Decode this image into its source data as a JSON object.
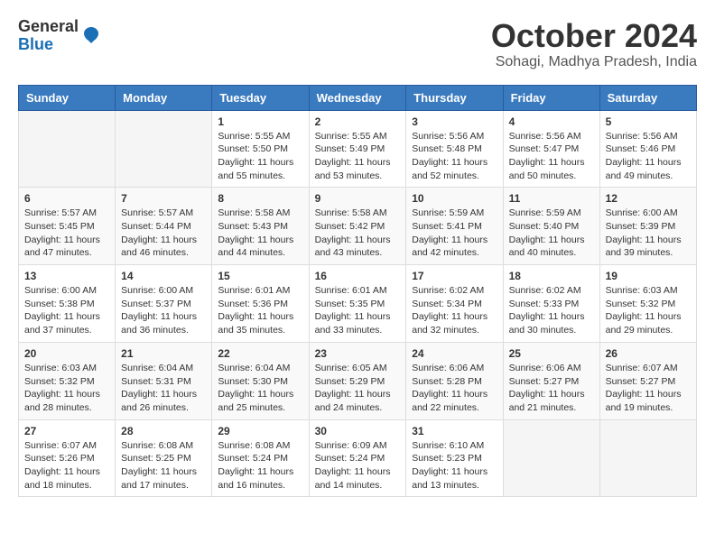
{
  "logo": {
    "general": "General",
    "blue": "Blue"
  },
  "title": "October 2024",
  "subtitle": "Sohagi, Madhya Pradesh, India",
  "headers": [
    "Sunday",
    "Monday",
    "Tuesday",
    "Wednesday",
    "Thursday",
    "Friday",
    "Saturday"
  ],
  "weeks": [
    [
      {
        "day": "",
        "info": ""
      },
      {
        "day": "",
        "info": ""
      },
      {
        "day": "1",
        "info": "Sunrise: 5:55 AM\nSunset: 5:50 PM\nDaylight: 11 hours and 55 minutes."
      },
      {
        "day": "2",
        "info": "Sunrise: 5:55 AM\nSunset: 5:49 PM\nDaylight: 11 hours and 53 minutes."
      },
      {
        "day": "3",
        "info": "Sunrise: 5:56 AM\nSunset: 5:48 PM\nDaylight: 11 hours and 52 minutes."
      },
      {
        "day": "4",
        "info": "Sunrise: 5:56 AM\nSunset: 5:47 PM\nDaylight: 11 hours and 50 minutes."
      },
      {
        "day": "5",
        "info": "Sunrise: 5:56 AM\nSunset: 5:46 PM\nDaylight: 11 hours and 49 minutes."
      }
    ],
    [
      {
        "day": "6",
        "info": "Sunrise: 5:57 AM\nSunset: 5:45 PM\nDaylight: 11 hours and 47 minutes."
      },
      {
        "day": "7",
        "info": "Sunrise: 5:57 AM\nSunset: 5:44 PM\nDaylight: 11 hours and 46 minutes."
      },
      {
        "day": "8",
        "info": "Sunrise: 5:58 AM\nSunset: 5:43 PM\nDaylight: 11 hours and 44 minutes."
      },
      {
        "day": "9",
        "info": "Sunrise: 5:58 AM\nSunset: 5:42 PM\nDaylight: 11 hours and 43 minutes."
      },
      {
        "day": "10",
        "info": "Sunrise: 5:59 AM\nSunset: 5:41 PM\nDaylight: 11 hours and 42 minutes."
      },
      {
        "day": "11",
        "info": "Sunrise: 5:59 AM\nSunset: 5:40 PM\nDaylight: 11 hours and 40 minutes."
      },
      {
        "day": "12",
        "info": "Sunrise: 6:00 AM\nSunset: 5:39 PM\nDaylight: 11 hours and 39 minutes."
      }
    ],
    [
      {
        "day": "13",
        "info": "Sunrise: 6:00 AM\nSunset: 5:38 PM\nDaylight: 11 hours and 37 minutes."
      },
      {
        "day": "14",
        "info": "Sunrise: 6:00 AM\nSunset: 5:37 PM\nDaylight: 11 hours and 36 minutes."
      },
      {
        "day": "15",
        "info": "Sunrise: 6:01 AM\nSunset: 5:36 PM\nDaylight: 11 hours and 35 minutes."
      },
      {
        "day": "16",
        "info": "Sunrise: 6:01 AM\nSunset: 5:35 PM\nDaylight: 11 hours and 33 minutes."
      },
      {
        "day": "17",
        "info": "Sunrise: 6:02 AM\nSunset: 5:34 PM\nDaylight: 11 hours and 32 minutes."
      },
      {
        "day": "18",
        "info": "Sunrise: 6:02 AM\nSunset: 5:33 PM\nDaylight: 11 hours and 30 minutes."
      },
      {
        "day": "19",
        "info": "Sunrise: 6:03 AM\nSunset: 5:32 PM\nDaylight: 11 hours and 29 minutes."
      }
    ],
    [
      {
        "day": "20",
        "info": "Sunrise: 6:03 AM\nSunset: 5:32 PM\nDaylight: 11 hours and 28 minutes."
      },
      {
        "day": "21",
        "info": "Sunrise: 6:04 AM\nSunset: 5:31 PM\nDaylight: 11 hours and 26 minutes."
      },
      {
        "day": "22",
        "info": "Sunrise: 6:04 AM\nSunset: 5:30 PM\nDaylight: 11 hours and 25 minutes."
      },
      {
        "day": "23",
        "info": "Sunrise: 6:05 AM\nSunset: 5:29 PM\nDaylight: 11 hours and 24 minutes."
      },
      {
        "day": "24",
        "info": "Sunrise: 6:06 AM\nSunset: 5:28 PM\nDaylight: 11 hours and 22 minutes."
      },
      {
        "day": "25",
        "info": "Sunrise: 6:06 AM\nSunset: 5:27 PM\nDaylight: 11 hours and 21 minutes."
      },
      {
        "day": "26",
        "info": "Sunrise: 6:07 AM\nSunset: 5:27 PM\nDaylight: 11 hours and 19 minutes."
      }
    ],
    [
      {
        "day": "27",
        "info": "Sunrise: 6:07 AM\nSunset: 5:26 PM\nDaylight: 11 hours and 18 minutes."
      },
      {
        "day": "28",
        "info": "Sunrise: 6:08 AM\nSunset: 5:25 PM\nDaylight: 11 hours and 17 minutes."
      },
      {
        "day": "29",
        "info": "Sunrise: 6:08 AM\nSunset: 5:24 PM\nDaylight: 11 hours and 16 minutes."
      },
      {
        "day": "30",
        "info": "Sunrise: 6:09 AM\nSunset: 5:24 PM\nDaylight: 11 hours and 14 minutes."
      },
      {
        "day": "31",
        "info": "Sunrise: 6:10 AM\nSunset: 5:23 PM\nDaylight: 11 hours and 13 minutes."
      },
      {
        "day": "",
        "info": ""
      },
      {
        "day": "",
        "info": ""
      }
    ]
  ]
}
